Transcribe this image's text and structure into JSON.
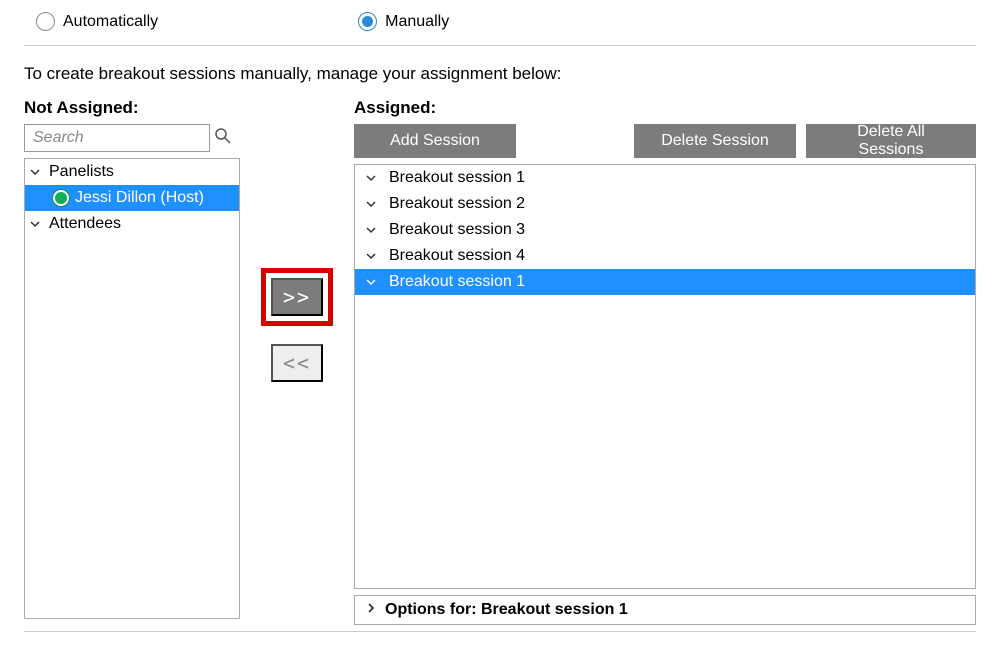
{
  "radios": {
    "automatic": {
      "label": "Automatically",
      "checked": false
    },
    "manual": {
      "label": "Manually",
      "checked": true
    }
  },
  "instruction": "To create breakout sessions manually, manage your assignment below:",
  "left": {
    "heading": "Not Assigned:",
    "search_placeholder": "Search",
    "groups": {
      "panelists": {
        "label": "Panelists",
        "expanded": true
      },
      "attendees": {
        "label": "Attendees",
        "expanded": true
      }
    },
    "panelist_host": "Jessi Dillon (Host)"
  },
  "transfer": {
    "right": ">>",
    "left": "<<"
  },
  "right": {
    "heading": "Assigned:",
    "buttons": {
      "add": "Add Session",
      "delete": "Delete Session",
      "delete_all": "Delete All Sessions"
    },
    "sessions": [
      {
        "label": "Breakout session 1",
        "selected": false
      },
      {
        "label": "Breakout session 2",
        "selected": false
      },
      {
        "label": "Breakout session 3",
        "selected": false
      },
      {
        "label": "Breakout session 4",
        "selected": false
      },
      {
        "label": "Breakout session 1",
        "selected": true
      }
    ],
    "options_label": "Options for: Breakout session 1"
  }
}
